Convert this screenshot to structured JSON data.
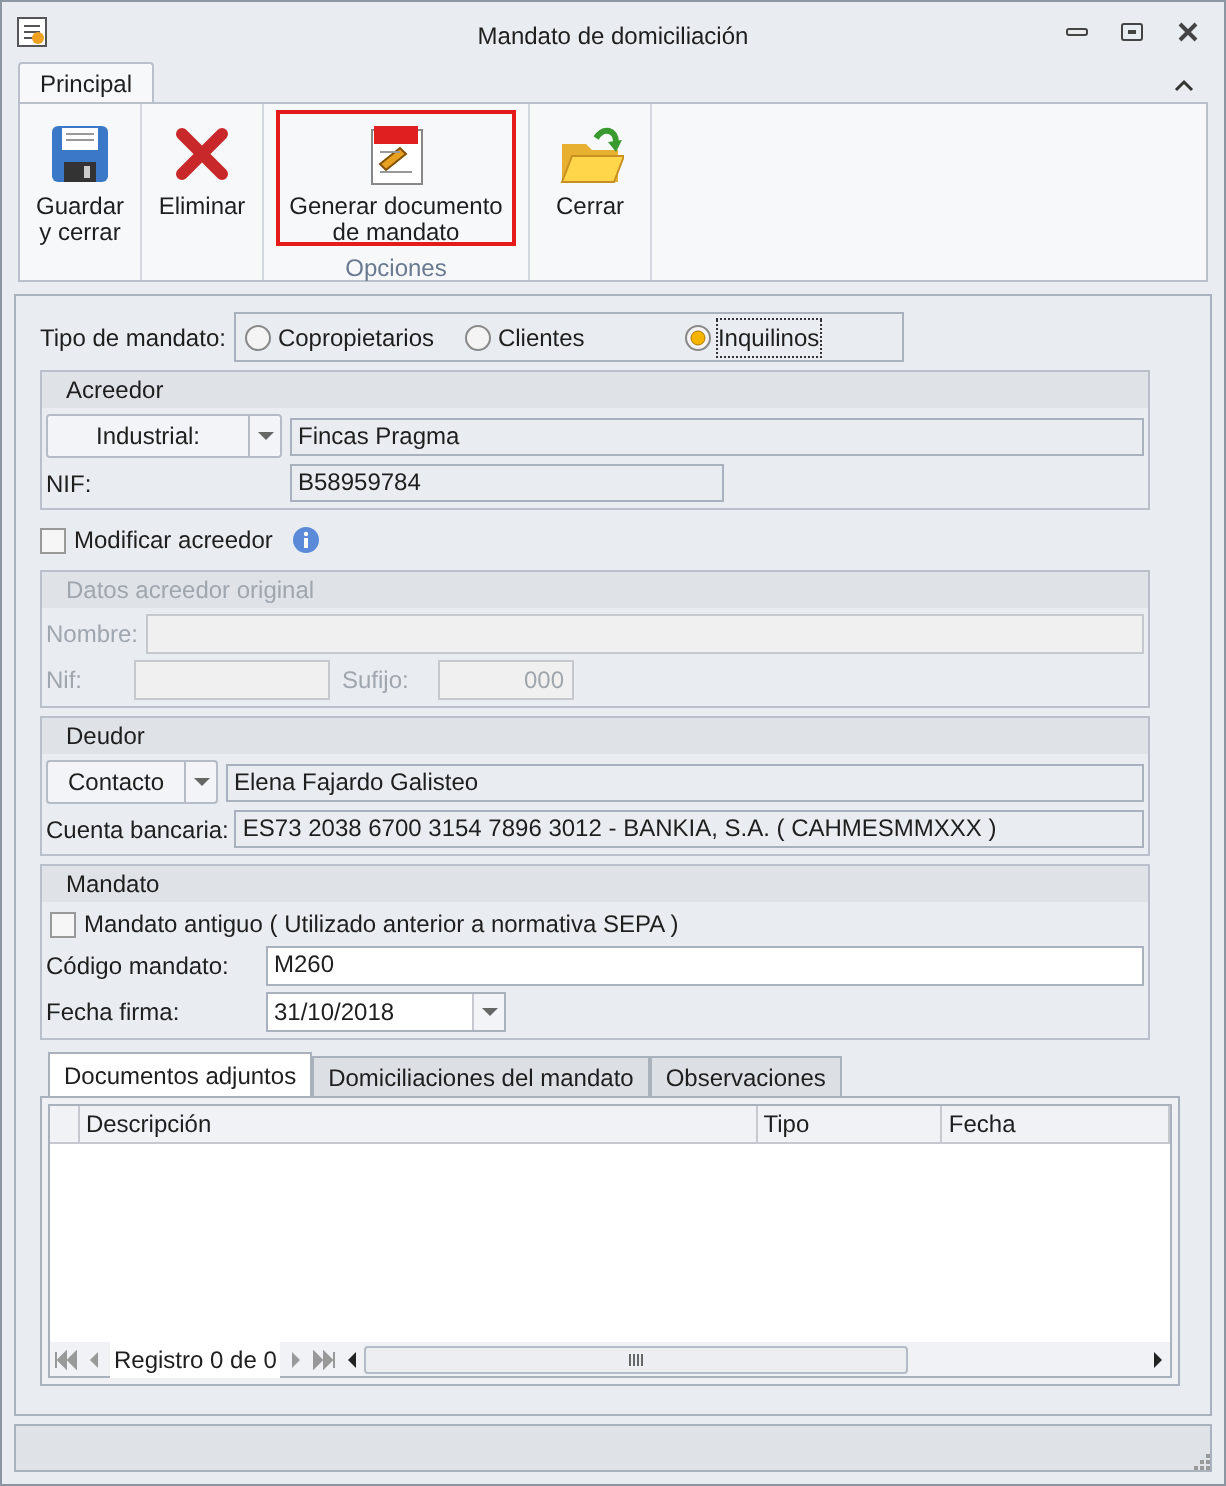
{
  "window": {
    "title": "Mandato de domiciliación"
  },
  "ribbon": {
    "tabs": [
      {
        "label": "Principal",
        "selected": true
      }
    ],
    "buttons": [
      {
        "kind": "save",
        "label": "Guardar y cerrar",
        "highlighted": false
      },
      {
        "kind": "delete",
        "label": "Eliminar",
        "highlighted": false
      },
      {
        "kind": "pdf",
        "label": "Generar documento de mandato",
        "highlighted": true
      },
      {
        "kind": "open",
        "label": "Cerrar",
        "highlighted": false
      }
    ],
    "group_label": "Opciones"
  },
  "mandate_type": {
    "label": "Tipo de mandato:",
    "options": [
      {
        "label": "Copropietarios",
        "selected": false
      },
      {
        "label": "Clientes",
        "selected": false
      },
      {
        "label": "Inquilinos",
        "selected": true
      }
    ]
  },
  "creditor": {
    "title": "Acreedor",
    "type_button": "Industrial:",
    "name": "Fincas Pragma",
    "nif_label": "NIF:",
    "nif": "B58959784"
  },
  "modify_creditor": {
    "label": "Modificar acreedor",
    "checked": false
  },
  "original_creditor": {
    "title": "Datos acreedor original",
    "disabled": true,
    "name_label": "Nombre:",
    "nif_label": "Nif:",
    "suffix_label": "Sufijo:",
    "suffix": "000"
  },
  "debtor": {
    "title": "Deudor",
    "type_button": "Contacto",
    "name": "Elena Fajardo Galisteo",
    "account_label": "Cuenta bancaria:",
    "account": "ES73 2038 6700 3154 7896 3012 - BANKIA, S.A. ( CAHMESMMXXX )"
  },
  "mandate": {
    "title": "Mandato",
    "old_mandate": {
      "label": "Mandato antiguo ( Utilizado anterior a normativa SEPA )",
      "checked": false
    },
    "code_label": "Código mandato:",
    "code": "M260",
    "date_label": "Fecha firma:",
    "date": "31/10/2018"
  },
  "detail_tabs": [
    {
      "label": "Documentos adjuntos",
      "selected": true
    },
    {
      "label": "Domiciliaciones del mandato",
      "selected": false
    },
    {
      "label": "Observaciones",
      "selected": false
    }
  ],
  "grid": {
    "columns": [
      "Descripción",
      "Tipo",
      "Fecha"
    ],
    "navigator": "Registro 0 de 0"
  }
}
